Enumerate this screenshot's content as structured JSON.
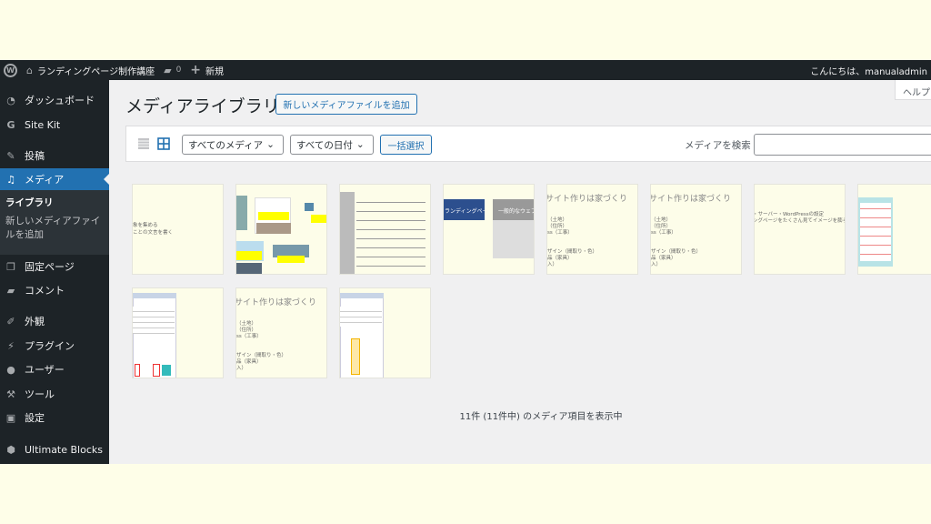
{
  "adminbar": {
    "site_name": "ランディングページ制作講座",
    "comments_count": "0",
    "new_label": "新規",
    "greeting": "こんにちは、manualadmin"
  },
  "sidebar": {
    "items": [
      {
        "label": "ダッシュボード",
        "icon": "dashboard-icon"
      },
      {
        "label": "Site Kit",
        "icon": "google-g-icon"
      },
      {
        "label": "投稿",
        "icon": "pin-icon"
      },
      {
        "label": "メディア",
        "icon": "media-icon"
      },
      {
        "label": "固定ページ",
        "icon": "pages-icon"
      },
      {
        "label": "コメント",
        "icon": "comment-icon"
      },
      {
        "label": "外観",
        "icon": "brush-icon"
      },
      {
        "label": "プラグイン",
        "icon": "plugin-icon"
      },
      {
        "label": "ユーザー",
        "icon": "user-icon"
      },
      {
        "label": "ツール",
        "icon": "wrench-icon"
      },
      {
        "label": "設定",
        "icon": "settings-icon"
      },
      {
        "label": "Ultimate Blocks",
        "icon": "blocks-icon"
      }
    ],
    "media_submenu": {
      "current": "ライブラリ",
      "other": "新しいメディアファイルを追加"
    }
  },
  "help_tab": "ヘルプ",
  "page": {
    "title": "メディアライブラリ",
    "add_new": "新しいメディアファイルを追加"
  },
  "toolbar": {
    "filter_type": "すべてのメディア",
    "filter_date": "すべての日付",
    "bulk_select": "一括選択",
    "search_label": "メディアを検索",
    "search_value": ""
  },
  "thumbnails": {
    "t1": [
      "象を集める",
      "ことの文言を書く"
    ],
    "t4": [
      "ランディングページ",
      "一般的なウェブサイト"
    ],
    "house": [
      "サイト作りは家づくり",
      "（土地）",
      "（住所）",
      "ss（工事）",
      "ザイン（間取り・色）",
      "品（家具）",
      "入）"
    ],
    "t9": [
      "・サーバー・WordPressの設定",
      "ングページをたくさん見てイメージを膨らま"
    ]
  },
  "footer": {
    "count_text": "11件 (11件中) のメディア項目を表示中"
  }
}
